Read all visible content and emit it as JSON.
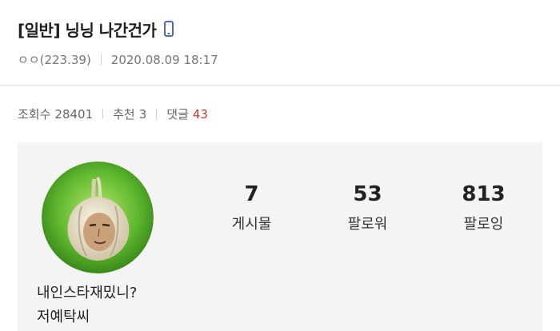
{
  "post": {
    "title": "[일반] 닝닝 나간건가",
    "author": "ㅇㅇ(223.39)",
    "datetime": "2020.08.09 18:17",
    "device_icon": "mobile-phone-icon"
  },
  "stats": {
    "views_label": "조회수",
    "views": "28401",
    "recommend_label": "추천",
    "recommend": "3",
    "comments_label": "댓글",
    "comments": "43"
  },
  "profile": {
    "avatar_icon": "garlic-avatar",
    "posts": "7",
    "posts_label": "게시물",
    "followers": "53",
    "followers_label": "팔로워",
    "following": "813",
    "following_label": "팔로잉",
    "bio_line1": "내인스타재밌니?",
    "bio_line2": "저예탁씨"
  },
  "colors": {
    "accent_comment": "#c0392b",
    "device_icon": "#3b5ba9",
    "embed_bg": "#f4f4f4"
  }
}
